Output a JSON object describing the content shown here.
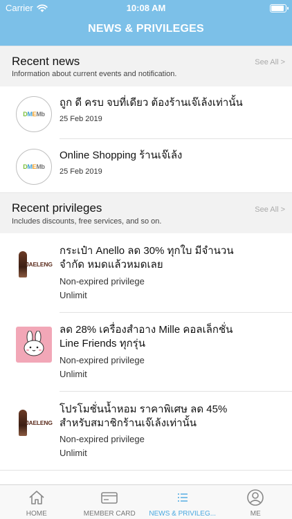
{
  "status_bar": {
    "carrier": "Carrier",
    "time": "10:08 AM",
    "battery_level_percent": 90
  },
  "header": {
    "title": "NEWS & PRIVILEGES"
  },
  "recent_news": {
    "title": "Recent news",
    "subtitle": "Information about current events and notification.",
    "see_all": "See All >",
    "items": [
      {
        "title": "ถูก ดี ครบ จบที่เดียว ต้องร้านเจ๊เล้งเท่านั้น",
        "date": "25 Feb 2019",
        "logo": "DMEMb"
      },
      {
        "title": "Online Shopping ร้านเจ๊เล้ง",
        "date": "25 Feb 2019",
        "logo": "DMEMb"
      }
    ]
  },
  "recent_privileges": {
    "title": "Recent privileges",
    "subtitle": "Includes discounts, free services, and so on.",
    "see_all": "See All >",
    "items": [
      {
        "title_line1": "กระเป๋า Anello ลด 30% ทุกใบ มีจำนวน",
        "title_line2": "จำกัด หมดแล้วหมดเลย",
        "status": "Non-expired privilege",
        "limit": "Unlimit",
        "thumb_text": "JAELENG"
      },
      {
        "title_line1": "ลด 28% เครื่องสำอาง Mille คอลเล็กชั่น",
        "title_line2": "Line Friends ทุกรุ่น",
        "status": "Non-expired privilege",
        "limit": "Unlimit",
        "thumb_text": ""
      },
      {
        "title_line1": "โปรโมชั่นน้ำหอม ราคาพิเศษ ลด 45%",
        "title_line2": "สำหรับสมาชิกร้านเจ๊เล้งเท่านั้น",
        "status": "Non-expired privilege",
        "limit": "Unlimit",
        "thumb_text": "JAELENG"
      }
    ]
  },
  "tabbar": {
    "tabs": [
      {
        "label": "HOME",
        "icon": "home-icon"
      },
      {
        "label": "MEMBER CARD",
        "icon": "card-icon"
      },
      {
        "label": "NEWS & PRIVILEG...",
        "icon": "list-icon"
      },
      {
        "label": "ME",
        "icon": "person-icon"
      }
    ],
    "active_color": "#4aa8e0"
  },
  "colors": {
    "header": "#7cc0e8",
    "section_bg": "#f2f2f2"
  }
}
